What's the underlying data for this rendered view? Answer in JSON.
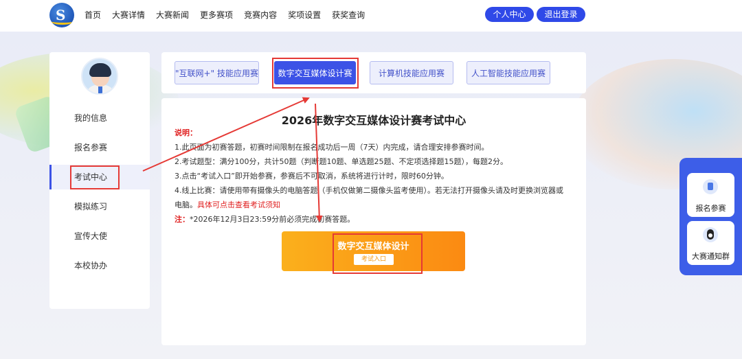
{
  "header": {
    "nav": [
      "首页",
      "大赛详情",
      "大赛新闻",
      "更多赛项",
      "竞赛内容",
      "奖项设置",
      "获奖查询"
    ],
    "personal_center": "个人中心",
    "logout": "退出登录"
  },
  "sidebar": {
    "items": [
      {
        "label": "我的信息"
      },
      {
        "label": "报名参赛"
      },
      {
        "label": "考试中心"
      },
      {
        "label": "模拟练习"
      },
      {
        "label": "宣传大使"
      },
      {
        "label": "本校协办"
      }
    ],
    "active_index": 2
  },
  "tabs": [
    {
      "label": "\"互联网+\" 技能应用赛"
    },
    {
      "label": "数字交互媒体设计赛"
    },
    {
      "label": "计算机技能应用赛"
    },
    {
      "label": "人工智能技能应用赛"
    }
  ],
  "content": {
    "title": "2026年数字交互媒体设计赛考试中心",
    "notes_heading": "说明：",
    "line1": "1.此页面为初赛答题，初赛时间限制在报名成功后一周（7天）内完成，请合理安排参赛时间。",
    "line2": "2.考试题型：满分100分，共计50题（判断题10题、单选题25题、不定项选择题15题），每题2分。",
    "line3": "3.点击“考试入口”即开始参赛，参赛后不可取消，系统将进行计时，限时60分钟。",
    "line4a": "4.线上比赛：请使用带有摄像头的电脑答题（手机仅做第二摄像头监考使用）。若无法打开摄像头请及时更换浏览器或",
    "line4b_prefix": "电脑。",
    "line4b_link": "具体可点击查看考试须知",
    "note_label": "注：",
    "note_text": "*2026年12月3日23:59分前必须完成初赛答题。",
    "entry_title": "数字交互媒体设计",
    "entry_button": "考试入口"
  },
  "float_panel": {
    "signup": "报名参赛",
    "group": "大赛通知群"
  },
  "colors": {
    "primary": "#3c52e6",
    "entry_gradient_start": "#fbb01c",
    "entry_gradient_end": "#fb8a12",
    "annotation_red": "#e53935",
    "note_red": "#e02020"
  }
}
